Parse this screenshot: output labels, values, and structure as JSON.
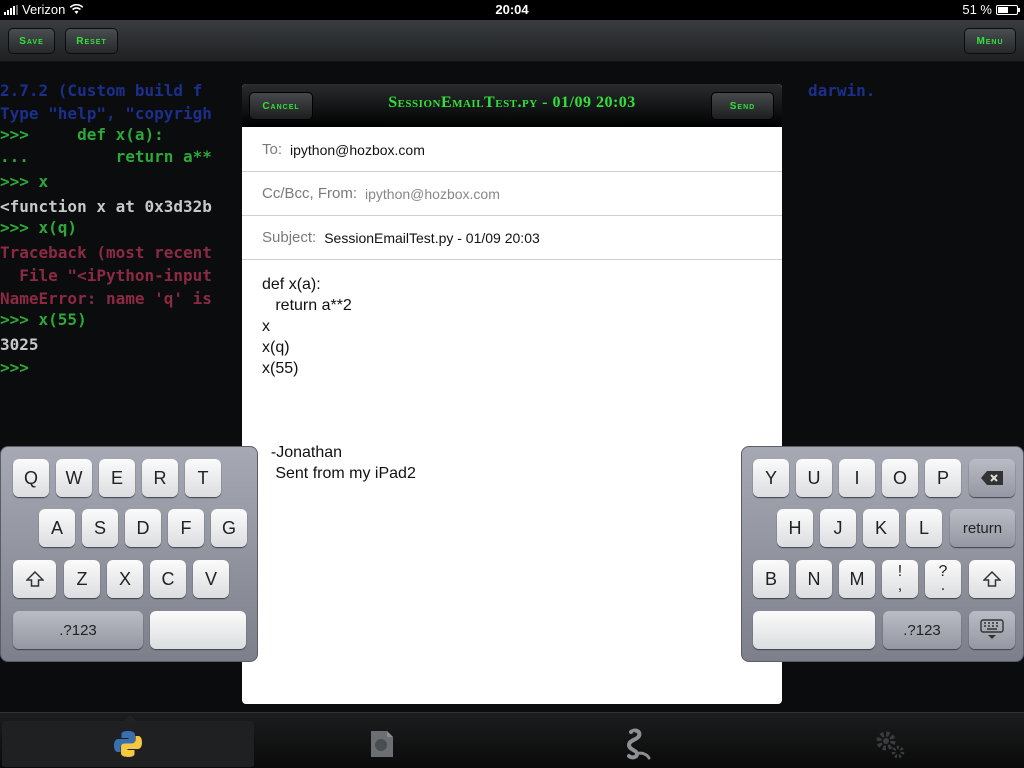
{
  "status_bar": {
    "carrier": "Verizon",
    "time": "20:04",
    "battery": "51 %",
    "battery_level": 0.51
  },
  "toolbar": {
    "save_label": "Save",
    "reset_label": "Reset",
    "menu_label": "Menu"
  },
  "console": {
    "lines": [
      {
        "text": "2.7.2 (Custom build f",
        "right": "darwin.",
        "color": "blue"
      },
      {
        "text": "Type \"help\", \"copyrigh",
        "color": "blue"
      },
      {
        "text": ">>>     def x(a):",
        "color": "green"
      },
      {
        "text": "...         return a**",
        "color": "green"
      },
      {
        "text": ">>> x",
        "color": "green"
      },
      {
        "text": "<function x at 0x3d32b",
        "color": "white"
      },
      {
        "text": ">>> x(q)",
        "color": "green"
      },
      {
        "text": "Traceback (most recent",
        "color": "red"
      },
      {
        "text": "  File \"<iPython-input",
        "color": "red"
      },
      {
        "text": "NameError: name 'q' is",
        "color": "red"
      },
      {
        "text": ">>> x(55)",
        "color": "green"
      },
      {
        "text": "3025",
        "color": "white"
      },
      {
        "text": ">>>",
        "color": "green"
      }
    ]
  },
  "email": {
    "title": "SessionEmailTest.py - 01/09 20:03",
    "cancel_label": "Cancel",
    "send_label": "Send",
    "to_label": "To:",
    "to_value": "ipython@hozbox.com",
    "ccbcc_label": "Cc/Bcc, From:",
    "ccbcc_value": "ipython@hozbox.com",
    "subject_label": "Subject:",
    "subject_value": "SessionEmailTest.py - 01/09 20:03",
    "body": "def x(a):\n   return a**2\nx\nx(q)\nx(55)\n\n\n\n  -Jonathan\n   Sent from my iPad2"
  },
  "keyboard": {
    "left_row1": [
      "Q",
      "W",
      "E",
      "R",
      "T"
    ],
    "left_row2": [
      "A",
      "S",
      "D",
      "F",
      "G"
    ],
    "left_row3": [
      "Z",
      "X",
      "C",
      "V"
    ],
    "numbers_label": ".?123",
    "right_row1": [
      "Y",
      "U",
      "I",
      "O",
      "P"
    ],
    "right_row2": [
      "H",
      "J",
      "K",
      "L"
    ],
    "return_label": "return",
    "right_row3": [
      "B",
      "N",
      "M"
    ],
    "exclaim_top": "!",
    "exclaim_bottom": ",",
    "question_top": "?",
    "question_bottom": "."
  },
  "tabs": [
    "python-icon",
    "document-icon",
    "snake-icon",
    "settings-icon"
  ],
  "colors": {
    "accent_green": "#33e03a",
    "prompt_green": "#2ea83a",
    "error_red": "#8c2a44",
    "banner_blue": "#1b2f8c"
  }
}
